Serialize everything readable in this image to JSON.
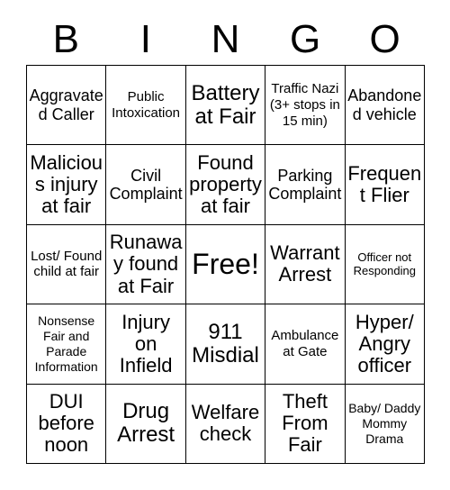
{
  "card": {
    "title": "BINGO",
    "header_letters": [
      "B",
      "I",
      "N",
      "G",
      "O"
    ],
    "colors": {
      "background": "#ffffff",
      "text": "#000000",
      "grid_line": "#000000"
    },
    "grid_size": "5x5",
    "free_space": {
      "row": 3,
      "column": 3,
      "label": "Free!"
    },
    "rows": [
      {
        "letter": "B",
        "cells": [
          {
            "text": "Aggravated Caller",
            "size": "md"
          },
          {
            "text": "Public Intoxication",
            "size": "sm"
          },
          {
            "text": "Battery at Fair",
            "size": "xl"
          },
          {
            "text": "Traffic Nazi (3+ stops in 15 min)",
            "size": "sm"
          },
          {
            "text": "Abandoned vehicle",
            "size": "md"
          }
        ]
      },
      {
        "letter": "I",
        "cells": [
          {
            "text": "Malicious injury at fair",
            "size": "lg"
          },
          {
            "text": "Civil Complaint",
            "size": "md"
          },
          {
            "text": "Found property at fair",
            "size": "lg"
          },
          {
            "text": "Parking Complaint",
            "size": "md"
          },
          {
            "text": "Frequent Flier",
            "size": "lg"
          }
        ]
      },
      {
        "letter": "N",
        "cells": [
          {
            "text": "Lost/ Found child at fair",
            "size": "sm"
          },
          {
            "text": "Runaway found at Fair",
            "size": "lg"
          },
          {
            "text": "Free!",
            "size": "xxl",
            "free": true
          },
          {
            "text": "Warrant Arrest",
            "size": "lg"
          },
          {
            "text": "Officer not Responding",
            "size": "xxs"
          }
        ]
      },
      {
        "letter": "G",
        "cells": [
          {
            "text": "Nonsense Fair and Parade Information",
            "size": "xs"
          },
          {
            "text": "Injury on Infield",
            "size": "lg"
          },
          {
            "text": "911 Misdial",
            "size": "xl"
          },
          {
            "text": "Ambulance at Gate",
            "size": "sm"
          },
          {
            "text": "Hyper/ Angry officer",
            "size": "lg"
          }
        ]
      },
      {
        "letter": "O",
        "cells": [
          {
            "text": "DUI before noon",
            "size": "lg"
          },
          {
            "text": "Drug Arrest",
            "size": "xl"
          },
          {
            "text": "Welfare check",
            "size": "lg"
          },
          {
            "text": "Theft From Fair",
            "size": "lg"
          },
          {
            "text": "Baby/ Daddy Mommy Drama",
            "size": "xs"
          }
        ]
      }
    ]
  }
}
